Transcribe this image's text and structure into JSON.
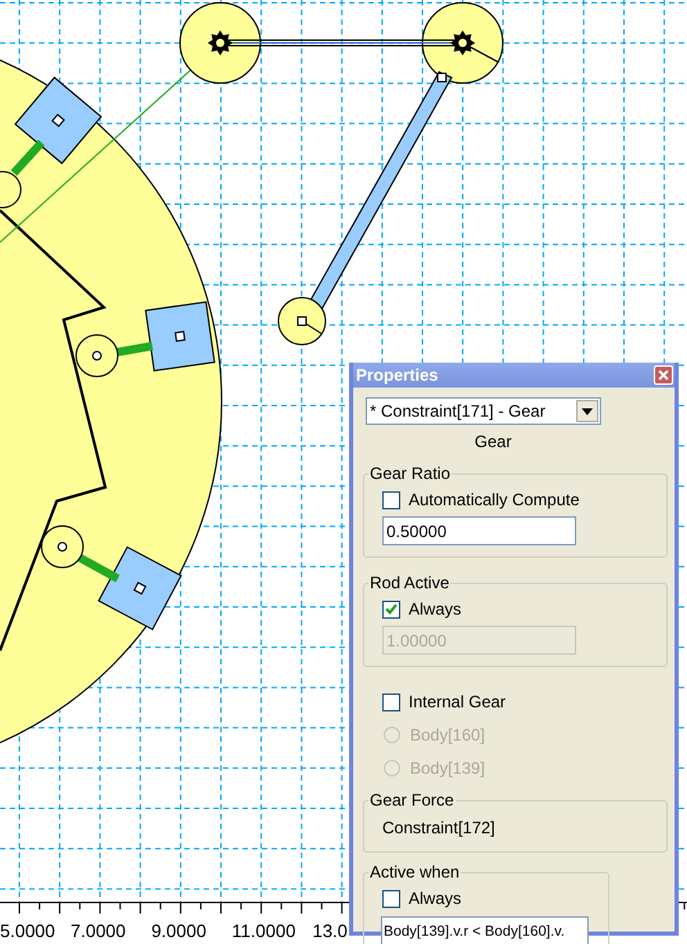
{
  "axis": {
    "labels": [
      "5.0000",
      "7.0000",
      "9.0000",
      "11.0000",
      "13.0"
    ]
  },
  "window": {
    "title": "Properties"
  },
  "object_select": {
    "value": "* Constraint[171] - Gear"
  },
  "type_label": "Gear",
  "gear_ratio": {
    "title": "Gear Ratio",
    "auto": {
      "label": "Automatically Compute",
      "checked": false
    },
    "value": "0.50000"
  },
  "rod_active": {
    "title": "Rod Active",
    "always": {
      "label": "Always",
      "checked": true
    },
    "value": "1.00000"
  },
  "internal_gear": {
    "label": "Internal Gear",
    "checked": false,
    "options": [
      {
        "label": "Body[160]",
        "selected": false,
        "disabled": true
      },
      {
        "label": "Body[139]",
        "selected": false,
        "disabled": true
      }
    ]
  },
  "gear_force": {
    "title": "Gear Force",
    "value": "Constraint[172]"
  },
  "active_when": {
    "title": "Active when",
    "always": {
      "label": "Always",
      "checked": false
    },
    "value": "Body[139].v.r < Body[160].v."
  }
}
